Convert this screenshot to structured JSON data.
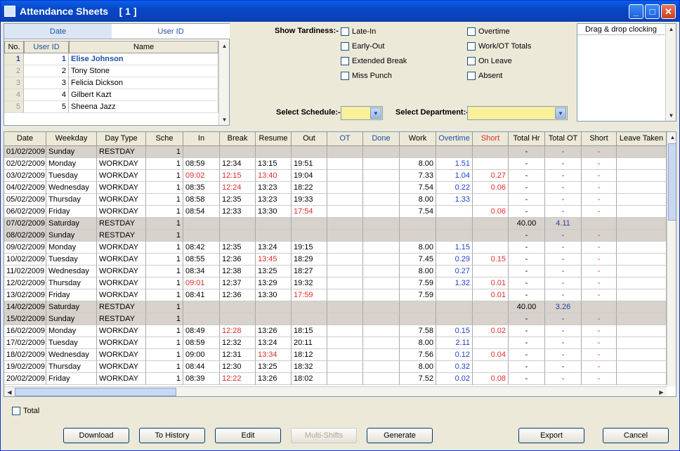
{
  "window": {
    "title": "Attendance Sheets",
    "instance": "[ 1 ]"
  },
  "employee_panel": {
    "tabs": [
      "Date",
      "User ID"
    ],
    "headers": [
      "No.",
      "User ID",
      "Name"
    ],
    "rows": [
      {
        "no": "1",
        "uid": "1",
        "name": "Elise Johnson"
      },
      {
        "no": "2",
        "uid": "2",
        "name": "Tony Stone"
      },
      {
        "no": "3",
        "uid": "3",
        "name": "Felicia Dickson"
      },
      {
        "no": "4",
        "uid": "4",
        "name": "Gilbert Kazt"
      },
      {
        "no": "5",
        "uid": "5",
        "name": "Sheena Jazz"
      }
    ]
  },
  "tardiness": {
    "label": "Show Tardiness:-",
    "options_left": [
      "Late-In",
      "Early-Out",
      "Extended Break",
      "Miss Punch"
    ],
    "options_right": [
      "Overtime",
      "Work/OT Totals",
      "On Leave",
      "Absent"
    ]
  },
  "schedule": {
    "label": "Select Schedule:-",
    "value": ""
  },
  "department": {
    "label": "Select Department:-",
    "value": ""
  },
  "dragdrop": {
    "title": "Drag & drop clocking"
  },
  "grid": {
    "headers": [
      "Date",
      "Weekday",
      "Day Type",
      "Sche",
      "In",
      "Break",
      "Resume",
      "Out",
      "OT",
      "Done",
      "Work",
      "Overtime",
      "Short",
      "Total Hr",
      "Total OT",
      "Short",
      "Leave Taken"
    ],
    "rows": [
      {
        "d": "01/02/2009",
        "w": "Sunday",
        "t": "RESTDAY",
        "s": "1",
        "in": "",
        "br": "",
        "re": "",
        "out": "",
        "ot": "",
        "dn": "",
        "wk": "",
        "ovt": "",
        "sh": "",
        "th": "-",
        "tot": "-",
        "sh2": "-",
        "rest": true
      },
      {
        "d": "02/02/2009",
        "w": "Monday",
        "t": "WORKDAY",
        "s": "1",
        "in": "08:59",
        "br": "12:34",
        "re": "13:15",
        "out": "19:51",
        "ot": "",
        "dn": "",
        "wk": "8.00",
        "ovt": "1.51",
        "sh": "",
        "th": "-",
        "tot": "-",
        "sh2": "-"
      },
      {
        "d": "03/02/2009",
        "w": "Tuesday",
        "t": "WORKDAY",
        "s": "1",
        "in": "09:02",
        "br": "12:15",
        "re": "13:40",
        "out": "19:04",
        "ot": "",
        "dn": "",
        "wk": "7.33",
        "ovt": "1.04",
        "sh": "0.27",
        "th": "-",
        "tot": "-",
        "sh2": "-",
        "rin": true,
        "rbr": true,
        "rre": true
      },
      {
        "d": "04/02/2009",
        "w": "Wednesday",
        "t": "WORKDAY",
        "s": "1",
        "in": "08:35",
        "br": "12:24",
        "re": "13:23",
        "out": "18:22",
        "ot": "",
        "dn": "",
        "wk": "7.54",
        "ovt": "0.22",
        "sh": "0.06",
        "th": "-",
        "tot": "-",
        "sh2": "-",
        "rbr": true
      },
      {
        "d": "05/02/2009",
        "w": "Thursday",
        "t": "WORKDAY",
        "s": "1",
        "in": "08:58",
        "br": "12:35",
        "re": "13:23",
        "out": "19:33",
        "ot": "",
        "dn": "",
        "wk": "8.00",
        "ovt": "1.33",
        "sh": "",
        "th": "-",
        "tot": "-",
        "sh2": "-"
      },
      {
        "d": "06/02/2009",
        "w": "Friday",
        "t": "WORKDAY",
        "s": "1",
        "in": "08:54",
        "br": "12:33",
        "re": "13:30",
        "out": "17:54",
        "ot": "",
        "dn": "",
        "wk": "7.54",
        "ovt": "",
        "sh": "0.06",
        "th": "-",
        "tot": "-",
        "sh2": "-",
        "rout": true
      },
      {
        "d": "07/02/2009",
        "w": "Saturday",
        "t": "RESTDAY",
        "s": "1",
        "in": "",
        "br": "",
        "re": "",
        "out": "",
        "ot": "",
        "dn": "",
        "wk": "",
        "ovt": "",
        "sh": "",
        "th": "40.00",
        "tot": "4.11",
        "sh2": "",
        "rest": true
      },
      {
        "d": "08/02/2009",
        "w": "Sunday",
        "t": "RESTDAY",
        "s": "1",
        "in": "",
        "br": "",
        "re": "",
        "out": "",
        "ot": "",
        "dn": "",
        "wk": "",
        "ovt": "",
        "sh": "",
        "th": "-",
        "tot": "-",
        "sh2": "-",
        "rest": true
      },
      {
        "d": "09/02/2009",
        "w": "Monday",
        "t": "WORKDAY",
        "s": "1",
        "in": "08:42",
        "br": "12:35",
        "re": "13:24",
        "out": "19:15",
        "ot": "",
        "dn": "",
        "wk": "8.00",
        "ovt": "1.15",
        "sh": "",
        "th": "-",
        "tot": "-",
        "sh2": "-"
      },
      {
        "d": "10/02/2009",
        "w": "Tuesday",
        "t": "WORKDAY",
        "s": "1",
        "in": "08:55",
        "br": "12:36",
        "re": "13:45",
        "out": "18:29",
        "ot": "",
        "dn": "",
        "wk": "7.45",
        "ovt": "0.29",
        "sh": "0.15",
        "th": "-",
        "tot": "-",
        "sh2": "-",
        "rre": true
      },
      {
        "d": "11/02/2009",
        "w": "Wednesday",
        "t": "WORKDAY",
        "s": "1",
        "in": "08:34",
        "br": "12:38",
        "re": "13:25",
        "out": "18:27",
        "ot": "",
        "dn": "",
        "wk": "8.00",
        "ovt": "0.27",
        "sh": "",
        "th": "-",
        "tot": "-",
        "sh2": "-"
      },
      {
        "d": "12/02/2009",
        "w": "Thursday",
        "t": "WORKDAY",
        "s": "1",
        "in": "09:01",
        "br": "12:37",
        "re": "13:29",
        "out": "19:32",
        "ot": "",
        "dn": "",
        "wk": "7.59",
        "ovt": "1.32",
        "sh": "0.01",
        "th": "-",
        "tot": "-",
        "sh2": "-",
        "rin": true
      },
      {
        "d": "13/02/2009",
        "w": "Friday",
        "t": "WORKDAY",
        "s": "1",
        "in": "08:41",
        "br": "12:36",
        "re": "13:30",
        "out": "17:59",
        "ot": "",
        "dn": "",
        "wk": "7.59",
        "ovt": "",
        "sh": "0.01",
        "th": "-",
        "tot": "-",
        "sh2": "-",
        "rout": true
      },
      {
        "d": "14/02/2009",
        "w": "Saturday",
        "t": "RESTDAY",
        "s": "1",
        "in": "",
        "br": "",
        "re": "",
        "out": "",
        "ot": "",
        "dn": "",
        "wk": "",
        "ovt": "",
        "sh": "",
        "th": "40.00",
        "tot": "3.26",
        "sh2": "",
        "rest": true
      },
      {
        "d": "15/02/2009",
        "w": "Sunday",
        "t": "RESTDAY",
        "s": "1",
        "in": "",
        "br": "",
        "re": "",
        "out": "",
        "ot": "",
        "dn": "",
        "wk": "",
        "ovt": "",
        "sh": "",
        "th": "-",
        "tot": "-",
        "sh2": "-",
        "rest": true
      },
      {
        "d": "16/02/2009",
        "w": "Monday",
        "t": "WORKDAY",
        "s": "1",
        "in": "08:49",
        "br": "12:28",
        "re": "13:26",
        "out": "18:15",
        "ot": "",
        "dn": "",
        "wk": "7.58",
        "ovt": "0.15",
        "sh": "0.02",
        "th": "-",
        "tot": "-",
        "sh2": "-",
        "rbr": true
      },
      {
        "d": "17/02/2009",
        "w": "Tuesday",
        "t": "WORKDAY",
        "s": "1",
        "in": "08:59",
        "br": "12:32",
        "re": "13:24",
        "out": "20:11",
        "ot": "",
        "dn": "",
        "wk": "8.00",
        "ovt": "2.11",
        "sh": "",
        "th": "-",
        "tot": "-",
        "sh2": "-"
      },
      {
        "d": "18/02/2009",
        "w": "Wednesday",
        "t": "WORKDAY",
        "s": "1",
        "in": "09:00",
        "br": "12:31",
        "re": "13:34",
        "out": "18:12",
        "ot": "",
        "dn": "",
        "wk": "7.56",
        "ovt": "0.12",
        "sh": "0.04",
        "th": "-",
        "tot": "-",
        "sh2": "-",
        "rre": true
      },
      {
        "d": "19/02/2009",
        "w": "Thursday",
        "t": "WORKDAY",
        "s": "1",
        "in": "08:44",
        "br": "12:30",
        "re": "13:25",
        "out": "18:32",
        "ot": "",
        "dn": "",
        "wk": "8.00",
        "ovt": "0.32",
        "sh": "",
        "th": "-",
        "tot": "-",
        "sh2": "-"
      },
      {
        "d": "20/02/2009",
        "w": "Friday",
        "t": "WORKDAY",
        "s": "1",
        "in": "08:39",
        "br": "12:22",
        "re": "13:26",
        "out": "18:02",
        "ot": "",
        "dn": "",
        "wk": "7.52",
        "ovt": "0.02",
        "sh": "0.08",
        "th": "-",
        "tot": "-",
        "sh2": "-",
        "rbr": true
      }
    ]
  },
  "footer": {
    "total_label": "Total",
    "buttons": [
      "Download",
      "To History",
      "Edit",
      "Multi-Shifts",
      "Generate",
      "Export",
      "Cancel"
    ]
  },
  "colors": {
    "title_bar": "#0847c7",
    "rest_row": "#d7d2cb",
    "late": "#e02b2b",
    "overtime": "#1f3fcf",
    "select_bg": "#faf09a"
  }
}
